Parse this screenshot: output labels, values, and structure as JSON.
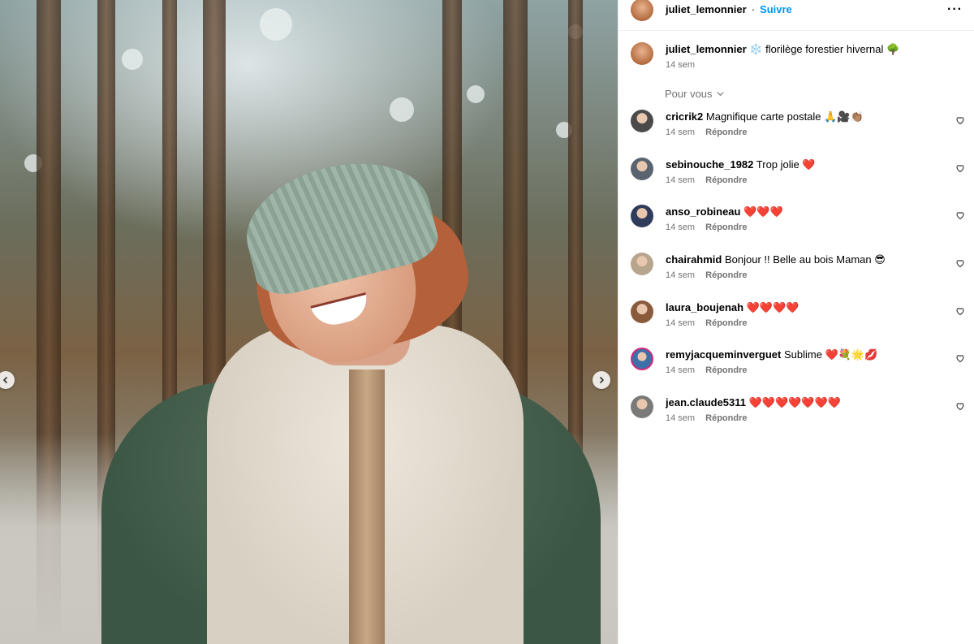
{
  "post": {
    "username": "juliet_lemonnier",
    "follow_label": "Suivre",
    "separator": "·",
    "more_label": "···",
    "caption_text": "❄️ florilège forestier hivernal 🌳",
    "caption_time": "14 sem"
  },
  "for_you_label": "Pour vous",
  "reply_label": "Répondre",
  "comments": [
    {
      "username": "cricrik2",
      "text": "Magnifique carte postale 🙏🎥👏🏽",
      "time": "14 sem",
      "avatar_color": "#4a4a4a"
    },
    {
      "username": "sebinouche_1982",
      "text": "Trop jolie ❤️",
      "time": "14 sem",
      "avatar_color": "#5a6470"
    },
    {
      "username": "anso_robineau",
      "text": "❤️❤️❤️",
      "time": "14 sem",
      "avatar_color": "#2e3b5a"
    },
    {
      "username": "chairahmid",
      "text": "Bonjour !! Belle au bois Maman 😎",
      "time": "14 sem",
      "avatar_color": "#b8a58e"
    },
    {
      "username": "laura_boujenah",
      "text": "❤️❤️❤️❤️",
      "time": "14 sem",
      "avatar_color": "#8a5a3c"
    },
    {
      "username": "remyjacqueminverguet",
      "text": "Sublime ❤️💐🌟💋",
      "time": "14 sem",
      "avatar_color": "#3d6fa8"
    },
    {
      "username": "jean.claude5311",
      "text": "❤️❤️❤️❤️❤️❤️❤️",
      "time": "14 sem",
      "avatar_color": "#7a7a78"
    }
  ],
  "colors": {
    "accent": "#0095f6",
    "muted_text": "#737373",
    "border": "#efefef",
    "story_ring": "#d62976"
  }
}
